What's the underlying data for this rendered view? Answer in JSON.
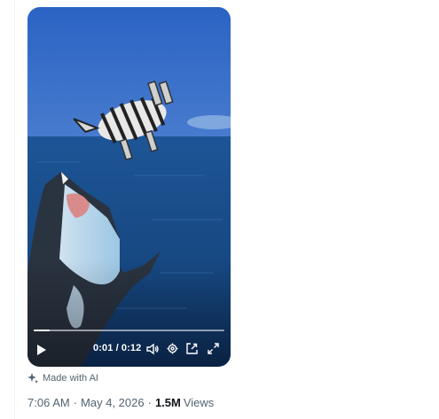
{
  "player": {
    "current_time": "0:01",
    "duration": "0:12",
    "progress": 0.083
  },
  "badge": {
    "label": "Made with AI",
    "icon": "sparkle-icon"
  },
  "post_meta": {
    "time": "7:06 AM",
    "separator": "·",
    "date": "May 4, 2026",
    "views_count": "1.5M",
    "views_label": "Views"
  },
  "colors": {
    "sky": "#2f69c5",
    "ocean": "#174b8a",
    "meta_gray": "#536471",
    "views_text": "#0f1419"
  }
}
